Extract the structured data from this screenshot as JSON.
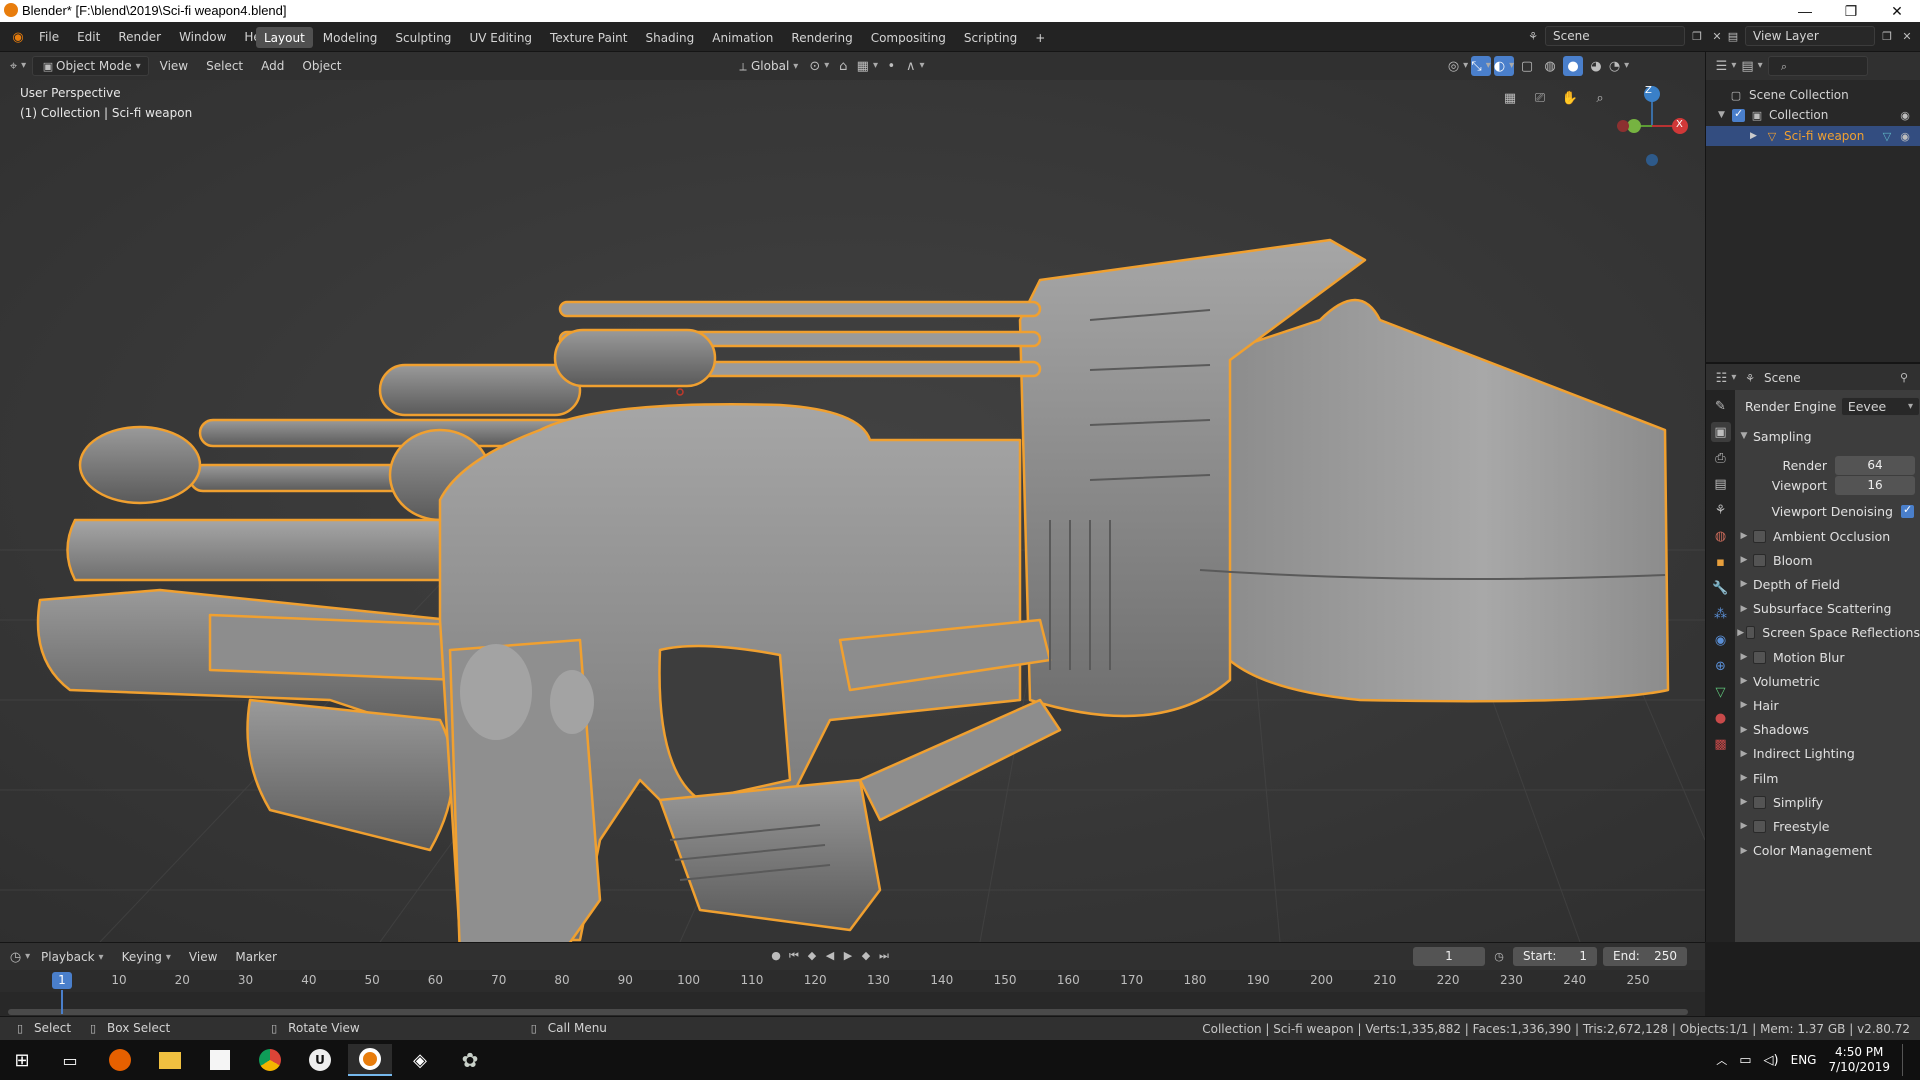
{
  "window": {
    "title": "Blender* [F:\\blend\\2019\\Sci-fi weapon4.blend]",
    "minimize": "—",
    "restore": "❐",
    "close": "✕"
  },
  "menu": [
    "File",
    "Edit",
    "Render",
    "Window",
    "Help"
  ],
  "workspaces": [
    "Layout",
    "Modeling",
    "Sculpting",
    "UV Editing",
    "Texture Paint",
    "Shading",
    "Animation",
    "Rendering",
    "Compositing",
    "Scripting"
  ],
  "workspace_add": "+",
  "scene_name": "Scene",
  "view_layer": "View Layer",
  "viewport_header": {
    "mode": "Object Mode",
    "menus": [
      "View",
      "Select",
      "Add",
      "Object"
    ],
    "orientation": "Global"
  },
  "viewport": {
    "perspective": "User Perspective",
    "collection_label": "(1) Collection | Sci-fi weapon",
    "gizmo": {
      "z": "Z",
      "x": "X"
    }
  },
  "outliner": {
    "root": "Scene Collection",
    "collection": "Collection",
    "object": "Sci-fi weapon"
  },
  "properties": {
    "context": "Scene",
    "render_engine_label": "Render Engine",
    "render_engine": "Eevee",
    "sampling": {
      "label": "Sampling",
      "render_label": "Render",
      "render": "64",
      "viewport_label": "Viewport",
      "viewport": "16",
      "denoise_label": "Viewport Denoising"
    },
    "panels": [
      {
        "label": "Ambient Occlusion",
        "checkbox": true
      },
      {
        "label": "Bloom",
        "checkbox": true
      },
      {
        "label": "Depth of Field",
        "checkbox": false
      },
      {
        "label": "Subsurface Scattering",
        "checkbox": false
      },
      {
        "label": "Screen Space Reflections",
        "checkbox": true
      },
      {
        "label": "Motion Blur",
        "checkbox": true
      },
      {
        "label": "Volumetric",
        "checkbox": false
      },
      {
        "label": "Hair",
        "checkbox": false
      },
      {
        "label": "Shadows",
        "checkbox": false
      },
      {
        "label": "Indirect Lighting",
        "checkbox": false
      },
      {
        "label": "Film",
        "checkbox": false
      },
      {
        "label": "Simplify",
        "checkbox": true
      },
      {
        "label": "Freestyle",
        "checkbox": true
      },
      {
        "label": "Color Management",
        "checkbox": false
      }
    ]
  },
  "timeline": {
    "menus": [
      "Playback",
      "Keying",
      "View",
      "Marker"
    ],
    "current_frame": "1",
    "start_label": "Start:",
    "start": "1",
    "end_label": "End:",
    "end": "250",
    "ticks": [
      "1",
      "10",
      "20",
      "30",
      "40",
      "50",
      "60",
      "70",
      "80",
      "90",
      "100",
      "110",
      "120",
      "130",
      "140",
      "150",
      "160",
      "170",
      "180",
      "190",
      "200",
      "210",
      "220",
      "230",
      "240",
      "250"
    ]
  },
  "status": {
    "select": "Select",
    "box_select": "Box Select",
    "rotate": "Rotate View",
    "call_menu": "Call Menu",
    "stats": "Collection | Sci-fi weapon | Verts:1,335,882 | Faces:1,336,390 | Tris:2,672,128 | Objects:1/1 | Mem: 1.37 GB | v2.80.72"
  },
  "taskbar": {
    "lang": "ENG",
    "time": "4:50 PM",
    "date": "7/10/2019"
  },
  "colors": {
    "selection_outline": "#f0a030",
    "accent_blue": "#4a7fcb",
    "viewport_bg": "#3b3b3b"
  }
}
